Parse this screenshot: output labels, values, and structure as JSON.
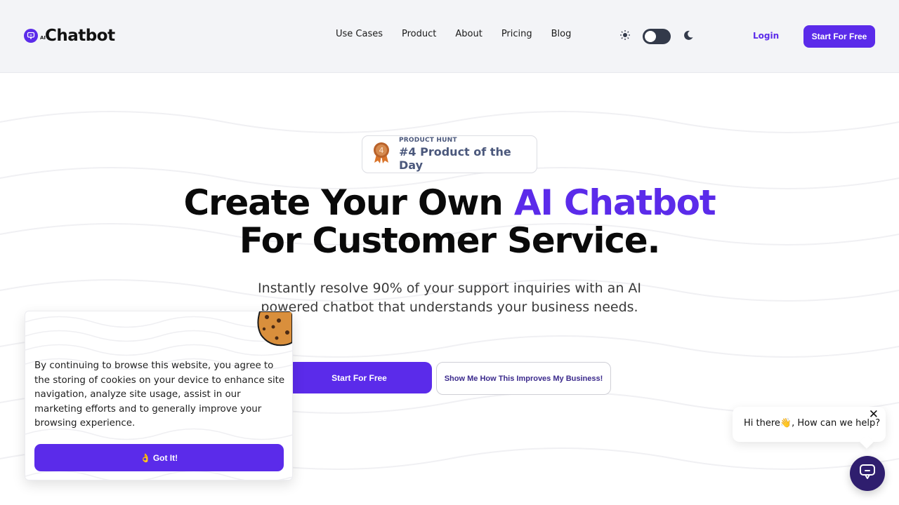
{
  "brand": {
    "name": "Chatbot",
    "prefix": "AI",
    "accent_color": "#5b2bea",
    "dark_color": "#2f1e6e"
  },
  "nav": {
    "items": [
      {
        "label": "Use Cases"
      },
      {
        "label": "Product"
      },
      {
        "label": "About"
      },
      {
        "label": "Pricing"
      },
      {
        "label": "Blog"
      }
    ]
  },
  "header": {
    "theme_toggle_state": "light",
    "login_label": "Login",
    "cta_label": "Start For Free"
  },
  "badge": {
    "icon": "medal-icon",
    "rank": "4",
    "label": "PRODUCT HUNT",
    "title": "#4 Product of the Day"
  },
  "hero": {
    "title_part1": "Create Your Own ",
    "title_accent": "AI Chatbot",
    "title_line2": "For Customer Service.",
    "subtitle": "Instantly resolve 90% of your support inquiries with an AI powered chatbot that understands your business needs.",
    "primary_cta": "Start For Free",
    "secondary_cta": "Show Me How This Improves My Business!"
  },
  "cookie_banner": {
    "icon": "cookie-icon",
    "text": "By continuing to browse this website, you agree to the storing of cookies on your device to enhance site navigation, analyze site usage, assist in our marketing efforts and to generally improve your browsing experience.",
    "button_emoji": "👌",
    "button_label": "Got It!"
  },
  "chat_widget": {
    "greeting": "Hi there👋, How can we help?",
    "close_glyph": "✕",
    "icon": "chat-icon"
  }
}
